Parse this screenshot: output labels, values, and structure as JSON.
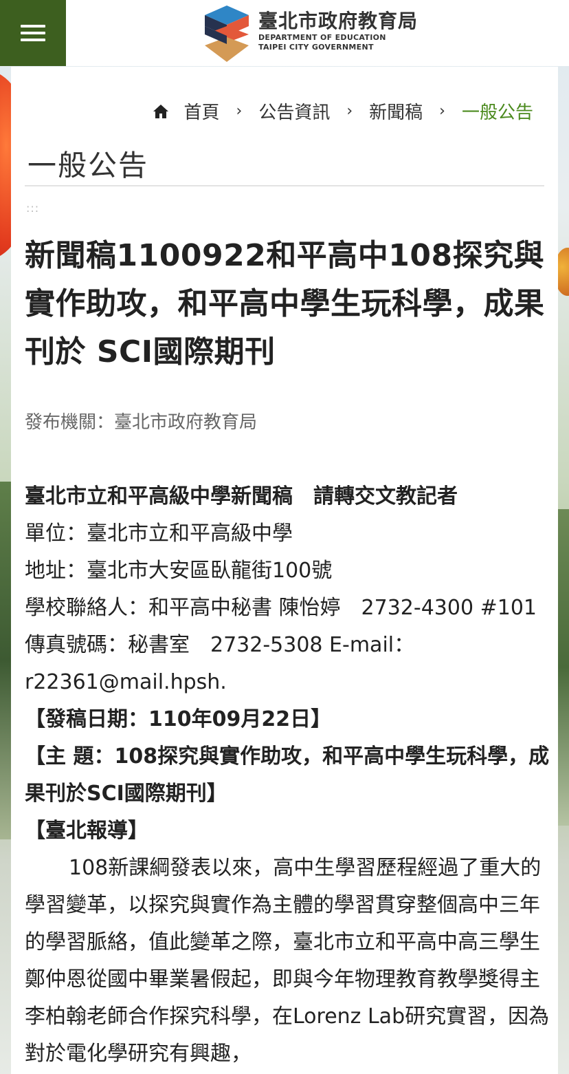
{
  "header": {
    "logo_zh": "臺北市政府教育局",
    "logo_en_1": "DEPARTMENT OF EDUCATION",
    "logo_en_2": "TAIPEI CITY GOVERNMENT",
    "menu_icon": "hamburger-menu-icon",
    "brand_color": "#3d5f1f"
  },
  "breadcrumb": {
    "home": "首頁",
    "item1": "公告資訊",
    "item2": "新聞稿",
    "current": "一般公告",
    "separator": "›"
  },
  "page_title": "一般公告",
  "article": {
    "dots": ":::",
    "title": "新聞稿1100922和平高中108探究與實作助攻，和平高中學生玩科學，成果刊於 SCI國際期刊",
    "publisher": "發布機關：臺北市政府教育局",
    "lines": {
      "header": "臺北市立和平高級中學新聞稿　請轉交文教記者",
      "unit": "單位：臺北市立和平高級中學",
      "address": "地址：臺北市大安區臥龍街100號",
      "contact": "學校聯絡人：和平高中秘書 陳怡婷　2732-4300 #101",
      "fax": "傳真號碼：秘書室　2732-5308 E-mail：",
      "email": "r22361@mail.hpsh.",
      "date": "【發稿日期：110年09月22日】",
      "subject": "【主 題：108探究與實作助攻，和平高中學生玩科學，成果刊於SCI國際期刊】",
      "report": "【臺北報導】",
      "paragraph": "108新課綱發表以來，高中生學習歷程經過了重大的學習變革，以探究與實作為主體的學習貫穿整個高中三年的學習脈絡，值此變革之際，臺北市立和平高中高三學生鄭仲恩從國中畢業暑假起，即與今年物理教育教學獎得主李柏翰老師合作探究科學，在Lorenz Lab研究實習，因為對於電化學研究有興趣，"
    }
  },
  "colors": {
    "breadcrumb_current": "#4b8a1e",
    "title_text": "#222222",
    "meta_text": "#666666"
  }
}
